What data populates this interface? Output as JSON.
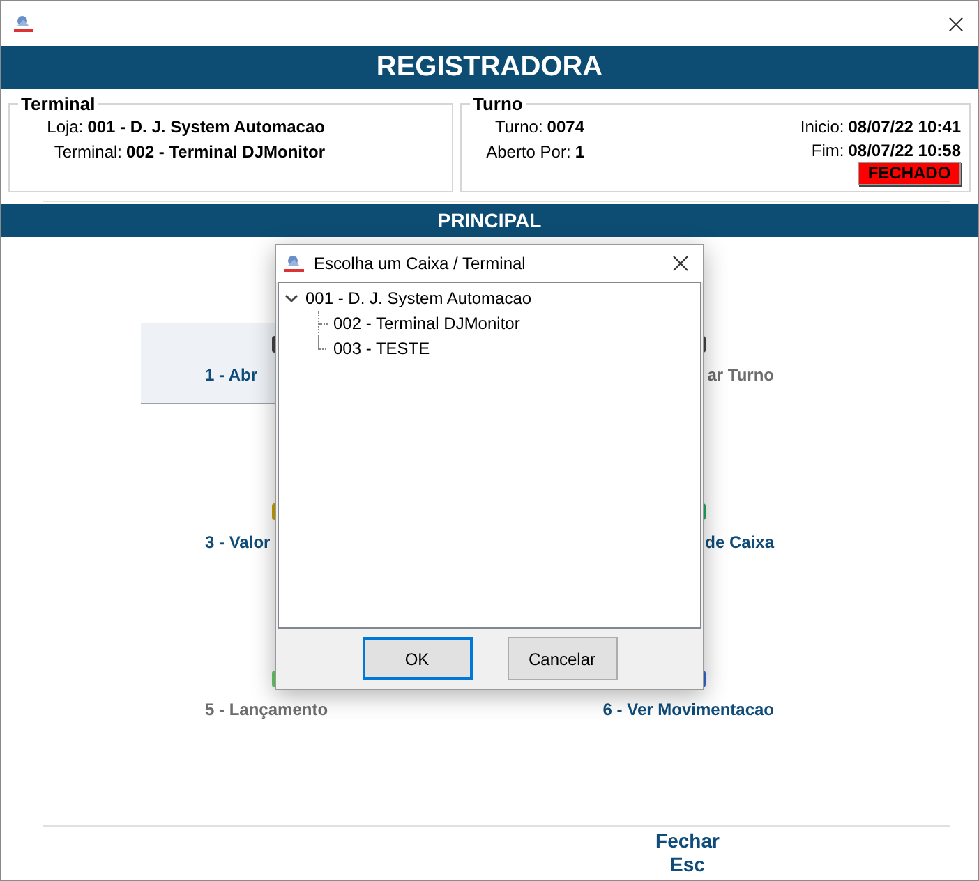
{
  "header": "REGISTRADORA",
  "terminal": {
    "title": "Terminal",
    "fields": [
      {
        "label": "Loja:",
        "value": "001 - D. J. System Automacao"
      },
      {
        "label": "Terminal:",
        "value": "002 - Terminal DJMonitor"
      }
    ]
  },
  "turno": {
    "title": "Turno",
    "fields": [
      {
        "label": "Turno:",
        "value": "0074"
      },
      {
        "label": "Aberto Por:",
        "value": "1"
      }
    ],
    "times": [
      {
        "label": "Inicio:",
        "value": "08/07/22 10:41"
      },
      {
        "label": "Fim:",
        "value": "08/07/22 10:58"
      }
    ],
    "status": "FECHADO"
  },
  "section": "PRINCIPAL",
  "menu": [
    {
      "label": "1 - Abr",
      "selected": true,
      "disabled": false
    },
    {
      "label": "ar Turno",
      "selected": false,
      "disabled": true
    },
    {
      "label": "3 - Valor",
      "selected": false,
      "disabled": false
    },
    {
      "label": "de Caixa",
      "selected": false,
      "disabled": false
    },
    {
      "label": "5 - Lançamento",
      "selected": false,
      "disabled": true
    },
    {
      "label": "6 - Ver Movimentacao",
      "selected": false,
      "disabled": false
    }
  ],
  "footer": {
    "label": "Fechar",
    "shortcut": "Esc"
  },
  "dialog": {
    "title": "Escolha um Caixa / Terminal",
    "tree": [
      {
        "label": "001 - D. J. System Automacao",
        "expanded": true,
        "children": [
          {
            "label": "002 - Terminal DJMonitor"
          },
          {
            "label": "003 - TESTE"
          }
        ]
      }
    ],
    "buttons": [
      {
        "label": "OK",
        "default": true
      },
      {
        "label": "Cancelar",
        "default": false
      }
    ]
  }
}
